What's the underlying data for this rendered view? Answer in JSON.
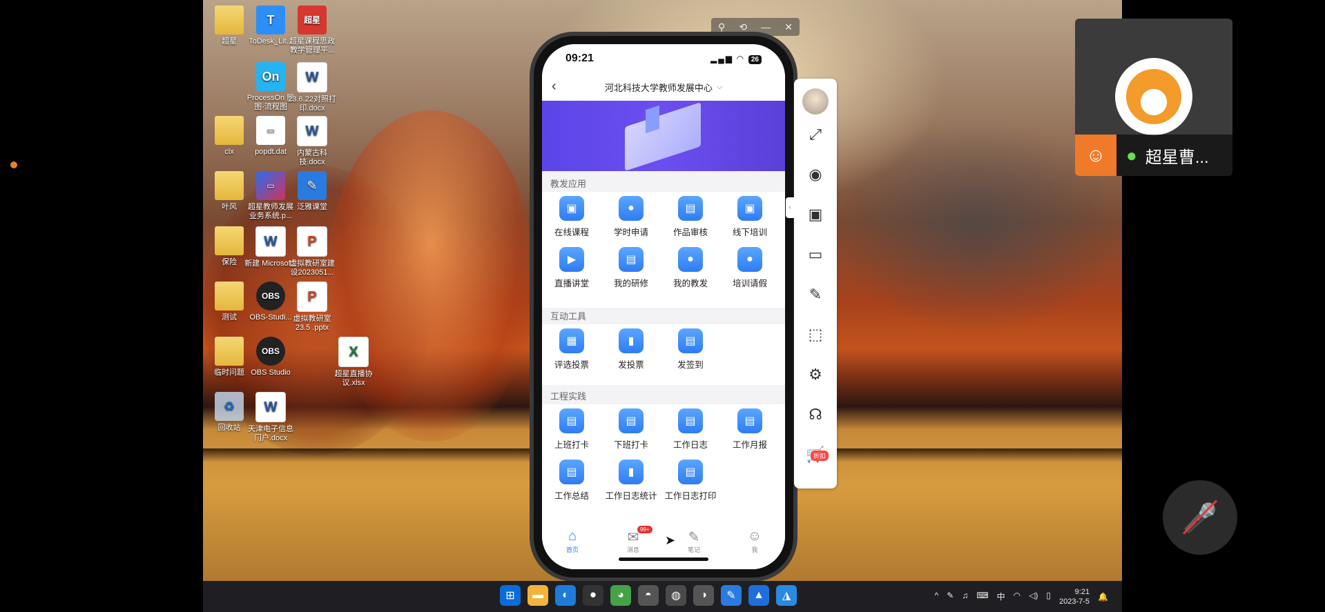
{
  "desktop_icons": [
    {
      "label": "超星",
      "type": "folder"
    },
    {
      "label": "ToDesk_Lit...",
      "type": "blue",
      "glyph": "T"
    },
    {
      "label": "超星课程思政教学管理平...",
      "type": "red",
      "glyph": "超星"
    },
    {
      "label": "ProcessOn 脑图-流程图",
      "type": "cyan",
      "glyph": "On"
    },
    {
      "label": "23.6.22对照打印.docx",
      "type": "word",
      "glyph": "W"
    },
    {
      "label": "clx",
      "type": "folder"
    },
    {
      "label": "popdt.dat",
      "type": "file",
      "glyph": "▭"
    },
    {
      "label": "内蒙古科技.docx",
      "type": "word",
      "glyph": "W"
    },
    {
      "label": "叶风",
      "type": "folder"
    },
    {
      "label": "超星教师发展业务系统.p...",
      "type": "card",
      "glyph": "▭"
    },
    {
      "label": "泛雅课堂",
      "type": "feather",
      "glyph": "✎"
    },
    {
      "label": "保险",
      "type": "folder"
    },
    {
      "label": "新建 Microsof...",
      "type": "word",
      "glyph": "W"
    },
    {
      "label": "虚拟教研室建设2023051...",
      "type": "ppt",
      "glyph": "P"
    },
    {
      "label": "测试",
      "type": "folder"
    },
    {
      "label": "OBS-Studi...",
      "type": "obs",
      "glyph": "OBS"
    },
    {
      "label": "虚拟教研室23.5 .pptx",
      "type": "ppt",
      "glyph": "P"
    },
    {
      "label": "临时问题",
      "type": "folder"
    },
    {
      "label": "OBS Studio",
      "type": "obs",
      "glyph": "OBS"
    },
    {
      "label": "超星直播协议.xlsx",
      "type": "excel",
      "glyph": "X"
    },
    {
      "label": "回收站",
      "type": "bin",
      "glyph": "♻"
    },
    {
      "label": "天津电子信息门户.docx",
      "type": "word",
      "glyph": "W"
    }
  ],
  "window_tools": [
    "⚲",
    "⟲",
    "—",
    "✕"
  ],
  "phone": {
    "time": "09:21",
    "signal": "▂▄▆ ◠",
    "battery": "26",
    "title": "河北科技大学教师发展中心",
    "back": "‹",
    "chevron": "⌵",
    "sections": [
      {
        "title": "教发应用",
        "items": [
          {
            "label": "在线课程",
            "icon": "▣"
          },
          {
            "label": "学时申请",
            "icon": "●"
          },
          {
            "label": "作品审核",
            "icon": "▤"
          },
          {
            "label": "线下培训",
            "icon": "▣"
          },
          {
            "label": "直播讲堂",
            "icon": "▶"
          },
          {
            "label": "我的研修",
            "icon": "▤"
          },
          {
            "label": "我的教发",
            "icon": "●"
          },
          {
            "label": "培训请假",
            "icon": "●"
          }
        ]
      },
      {
        "title": "互动工具",
        "items": [
          {
            "label": "评选投票",
            "icon": "▦"
          },
          {
            "label": "发投票",
            "icon": "▮"
          },
          {
            "label": "发签到",
            "icon": "▤"
          }
        ]
      },
      {
        "title": "工程实践",
        "items": [
          {
            "label": "上班打卡",
            "icon": "▤"
          },
          {
            "label": "下班打卡",
            "icon": "▤"
          },
          {
            "label": "工作日志",
            "icon": "▤"
          },
          {
            "label": "工作月报",
            "icon": "▤"
          },
          {
            "label": "工作总结",
            "icon": "▤"
          },
          {
            "label": "工作日志统计",
            "icon": "▮"
          },
          {
            "label": "工作日志打印",
            "icon": "▤"
          }
        ]
      }
    ],
    "tabs": [
      {
        "label": "首页",
        "icon": "⌂",
        "active": true
      },
      {
        "label": "消息",
        "icon": "✉",
        "badge": "99+"
      },
      {
        "label": "笔记",
        "icon": "✎"
      },
      {
        "label": "我",
        "icon": "☺"
      }
    ]
  },
  "tools_panel": {
    "handle": "‹",
    "items": [
      "⤢",
      "◉",
      "▣",
      "▭",
      "✎",
      "⬚",
      "⚙",
      "☊",
      "🛒"
    ],
    "cart_badge": "折扣"
  },
  "taskbar": {
    "icons": [
      "⊞",
      "▬",
      "◐",
      "⚫",
      "◕",
      "◓",
      "◍",
      "◑",
      "✎",
      "▲",
      "◮"
    ],
    "tray": [
      "^",
      "✎",
      "♫",
      "⌨",
      "中",
      "◠",
      "◁)",
      "▯"
    ],
    "time": "9:21",
    "date": "2023-7-5",
    "notify": "🔔"
  },
  "video": {
    "name": "超星曹...",
    "user_icon": "☺",
    "mic_icon": "●"
  },
  "mute_icon": "🎤",
  "cursor": "➤"
}
